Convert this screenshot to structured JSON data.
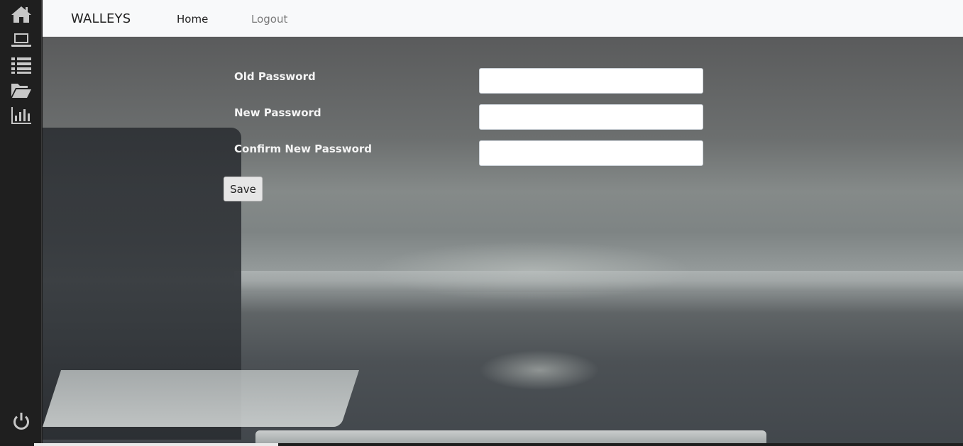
{
  "sidebar": {
    "items": [
      {
        "icon": "home-icon"
      },
      {
        "icon": "laptop-icon"
      },
      {
        "icon": "list-icon"
      },
      {
        "icon": "folder-open-icon"
      },
      {
        "icon": "bar-chart-icon"
      }
    ],
    "bottom_icon": "power-icon",
    "icon_color": "#c7c7c7",
    "background": "#1f1f1f"
  },
  "navbar": {
    "brand": "WALLEYS",
    "links": [
      {
        "label": "Home"
      },
      {
        "label": "Logout"
      }
    ]
  },
  "form": {
    "fields": [
      {
        "label": "Old Password",
        "value": ""
      },
      {
        "label": "New Password",
        "value": ""
      },
      {
        "label": "Confirm New Password",
        "value": ""
      }
    ],
    "save_label": "Save"
  }
}
